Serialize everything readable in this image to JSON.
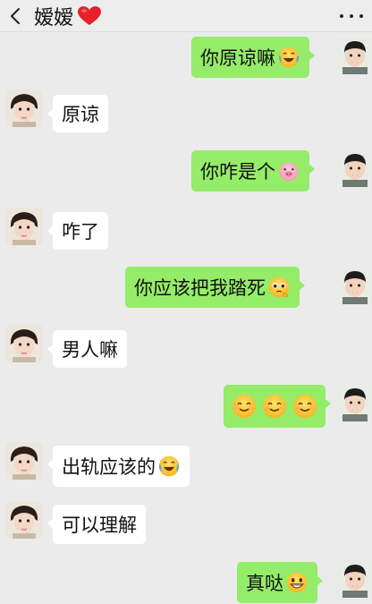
{
  "header": {
    "title": "嫒嫒"
  },
  "messages": [
    {
      "side": "out",
      "text": "你原谅嘛",
      "emoji": [
        "crying-laughing-emoji"
      ]
    },
    {
      "side": "in",
      "text": "原谅"
    },
    {
      "side": "out",
      "text": "你咋是个",
      "emoji": [
        "pig-face-emoji"
      ]
    },
    {
      "side": "in",
      "text": "咋了"
    },
    {
      "side": "out",
      "text": "你应该把我踏死",
      "emoji": [
        "pleading-emoji"
      ]
    },
    {
      "side": "in",
      "text": "男人嘛"
    },
    {
      "side": "out",
      "text": "",
      "emoji": [
        "smile-emoji",
        "smile-emoji",
        "smile-emoji"
      ]
    },
    {
      "side": "in",
      "text": "出轨应该的",
      "emoji": [
        "crying-laughing-emoji"
      ]
    },
    {
      "side": "in",
      "text": "可以理解"
    },
    {
      "side": "out",
      "text": "真哒",
      "emoji": [
        "grin-emoji"
      ]
    }
  ],
  "colors": {
    "outgoing_bubble": "#95ec69",
    "incoming_bubble": "#ffffff",
    "background": "#ebebeb",
    "header": "#ededed"
  }
}
